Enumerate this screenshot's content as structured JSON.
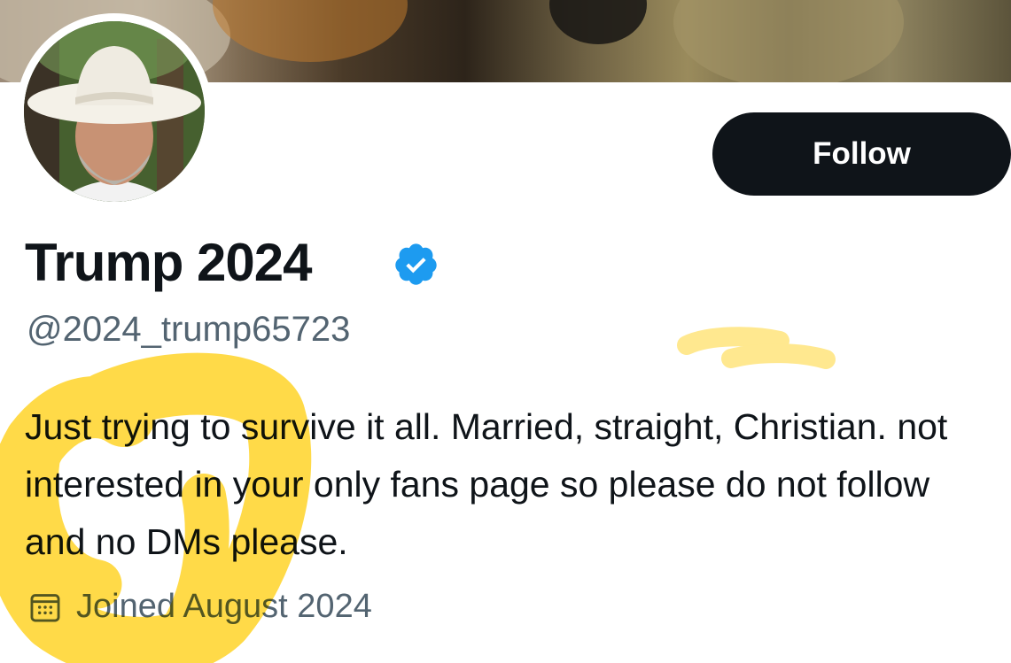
{
  "profile": {
    "display_name": "Trump 2024",
    "verified_icon": "verified-badge-icon",
    "handle": "@2024_trump65723",
    "bio": "Just trying to survive it all. Married, straight, Christian. not interested in your only fans page so please do not follow and no DMs please.",
    "joined": "Joined August 2024"
  },
  "actions": {
    "follow_label": "Follow"
  },
  "icons": {
    "calendar": "calendar-icon",
    "verified": "verified-badge-icon"
  },
  "colors": {
    "text": "#0f1419",
    "secondary": "#536471",
    "verified": "#1d9bf0",
    "button": "#0f1419",
    "highlighter": "#ffd21f"
  }
}
